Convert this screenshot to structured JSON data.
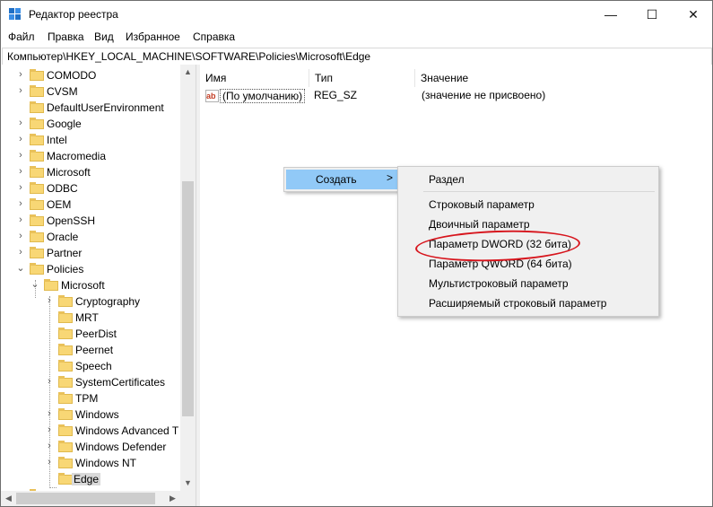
{
  "window": {
    "title": "Редактор реестра",
    "controls": {
      "minimize": "—",
      "maximize": "☐",
      "close": "✕"
    }
  },
  "menu": [
    "Файл",
    "Правка",
    "Вид",
    "Избранное",
    "Справка"
  ],
  "address": "Компьютер\\HKEY_LOCAL_MACHINE\\SOFTWARE\\Policies\\Microsoft\\Edge",
  "tree": {
    "level1": [
      "COMODO",
      "CVSM",
      "DefaultUserEnvironment",
      "Google",
      "Intel",
      "Macromedia",
      "Microsoft",
      "ODBC",
      "OEM",
      "OpenSSH",
      "Oracle",
      "Partner",
      "Policies"
    ],
    "level2": [
      "Microsoft"
    ],
    "level3": [
      "Cryptography",
      "MRT",
      "PeerDist",
      "Peernet",
      "Speech",
      "SystemCertificates",
      "TPM",
      "Windows",
      "Windows Advanced T",
      "Windows Defender",
      "Windows NT",
      "Edge"
    ],
    "selected": "Edge"
  },
  "list": {
    "columns": [
      "Имя",
      "Тип",
      "Значение"
    ],
    "rows": [
      {
        "name": "(По умолчанию)",
        "type": "REG_SZ",
        "value": "(значение не присвоено)",
        "icon": "string-value-icon"
      }
    ]
  },
  "context_menu": {
    "create_label": "Создать",
    "submenu_arrow": ">",
    "items": [
      "Раздел",
      "Строковый параметр",
      "Двоичный параметр",
      "Параметр DWORD (32 бита)",
      "Параметр QWORD (64 бита)",
      "Мультистроковый параметр",
      "Расширяемый строковый параметр"
    ],
    "highlighted": "Параметр DWORD (32 бита)",
    "highlight_color": "#d7141c"
  },
  "colors": {
    "selection": "#91c9f7",
    "folder": "#f8d775",
    "menu_bg": "#f0f0f0"
  }
}
